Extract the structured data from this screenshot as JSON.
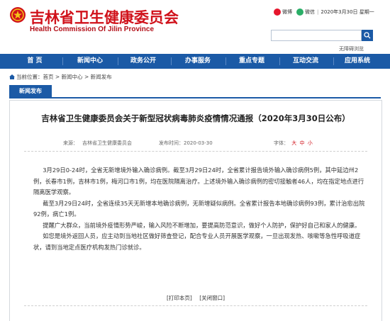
{
  "header": {
    "title": "吉林省卫生健康委员会",
    "subtitle": "Health Commission Of Jilin Province",
    "weibo": "微博",
    "wechat": "微信",
    "date": "2020年3月30日 星期一",
    "barrier_free": "无障碍浏览"
  },
  "nav": {
    "items": [
      "首 页",
      "新闻中心",
      "政务公开",
      "办事服务",
      "重点专题",
      "互动交流",
      "应用系统"
    ]
  },
  "breadcrumb": {
    "prefix": "当前位置：",
    "home": "首页",
    "sep1": " > ",
    "news": "新闻中心",
    "sep2": " > ",
    "current": "新闻发布"
  },
  "tab": {
    "label": "新闻发布"
  },
  "article": {
    "title": "吉林省卫生健康委员会关于新型冠状病毒肺炎疫情情况通报（2020年3月30日公布）",
    "source_label": "来源：",
    "source": "吉林省卫生健康委员会",
    "publish_label": "发布时间：",
    "publish_date": "2020-03-30",
    "font_label": "字体：",
    "font_large": "大",
    "font_medium": "中",
    "font_small": "小",
    "paragraphs": [
      "3月29日0-24时，全省无新增境外输入确诊病例。截至3月29日24时，全省累计报告境外输入确诊病例5例，其中延边州2例，长春市1例，吉林市1例，梅河口市1例，均在医院隔离治疗。上述境外输入确诊病例的密切接触者46人，均在指定地点进行隔离医学观察。",
      "截至3月29日24时，全省连续35天无新增本地确诊病例，无新增疑似病例。全省累计报告本地确诊病例93例，累计治愈出院92例，病亡1例。",
      "提醒广大群众，当前境外疫情形势严峻，输入风险不断增加，要提高防范意识，做好个人防护，保护好自己和家人的健康。",
      "如您是境外返回人员，应主动到当地社区做好筛查登记，配合专业人员开展医学观察，一旦出现发热、咳嗽等急性呼吸道症状，请到当地定点医疗机构发热门诊就诊。"
    ],
    "print_link": "[打印本页]",
    "close_link": "[关闭窗口]"
  },
  "colors": {
    "brand_red": "#d0121b",
    "nav_blue": "#1b5aa6",
    "font_ctl_red": "#d0121b"
  }
}
